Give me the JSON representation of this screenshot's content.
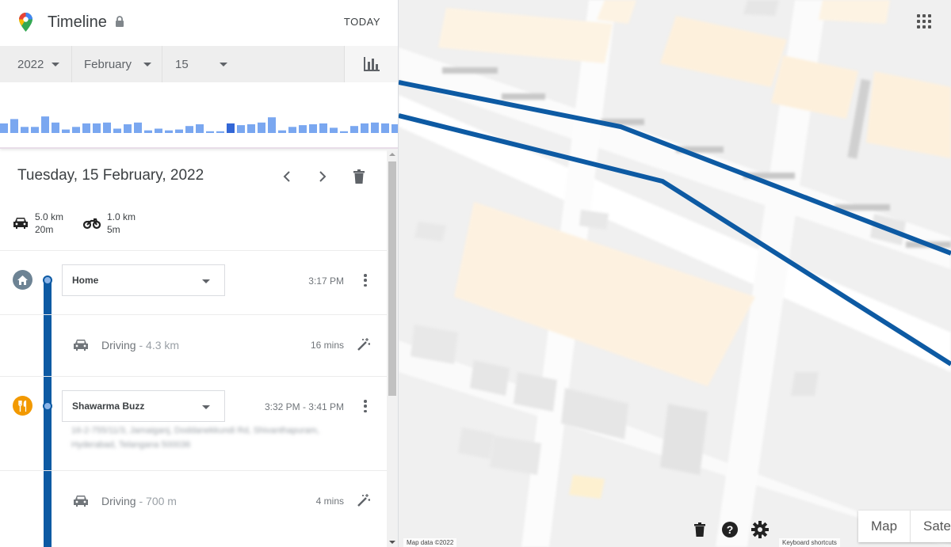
{
  "app": {
    "title": "Timeline",
    "today_label": "TODAY"
  },
  "date_selector": {
    "year": "2022",
    "month": "February",
    "day": "15"
  },
  "activity_histogram": {
    "values": [
      0.55,
      0.8,
      0.35,
      0.35,
      0.95,
      0.6,
      0.2,
      0.35,
      0.55,
      0.55,
      0.6,
      0.25,
      0.5,
      0.6,
      0.15,
      0.25,
      0.15,
      0.2,
      0.4,
      0.5,
      0.1,
      0.1,
      0.55,
      0.45,
      0.5,
      0.6,
      0.9,
      0.15,
      0.35,
      0.45,
      0.5,
      0.55,
      0.3,
      0.1,
      0.4,
      0.55,
      0.6,
      0.55,
      0.5,
      0.6
    ],
    "highlight_index": 22
  },
  "day": {
    "title": "Tuesday, 15 February, 2022",
    "summary": [
      {
        "icon": "car-icon",
        "distance": "5.0 km",
        "duration": "20m"
      },
      {
        "icon": "motorcycle-icon",
        "distance": "1.0 km",
        "duration": "5m"
      }
    ]
  },
  "timeline": {
    "home": {
      "name": "Home",
      "time": "3:17 PM"
    },
    "drive1": {
      "label": "Driving",
      "distance": "4.3 km",
      "duration": "16 mins"
    },
    "stop": {
      "name": "Shawarma Buzz",
      "time": "3:32 PM - 3:41 PM",
      "address": "16-2-755/11/3, Jamaiganj, Doddanekkundi Rd, Shivanthapuram, Hyderabad, Telangana 500036"
    },
    "drive2": {
      "label": "Driving",
      "distance": "700 m",
      "duration": "4 mins"
    }
  },
  "map": {
    "attribution": "Map data ©2022",
    "shortcuts": "Keyboard shortcuts",
    "type_map": "Map",
    "type_satellite": "Satellite"
  },
  "colors": {
    "route": "#0d5aa3",
    "histogram_bar": "#7aa7f0",
    "histogram_highlight": "#3367d6",
    "home_icon_bg": "#6d8394",
    "food_icon_bg": "#f29900"
  }
}
